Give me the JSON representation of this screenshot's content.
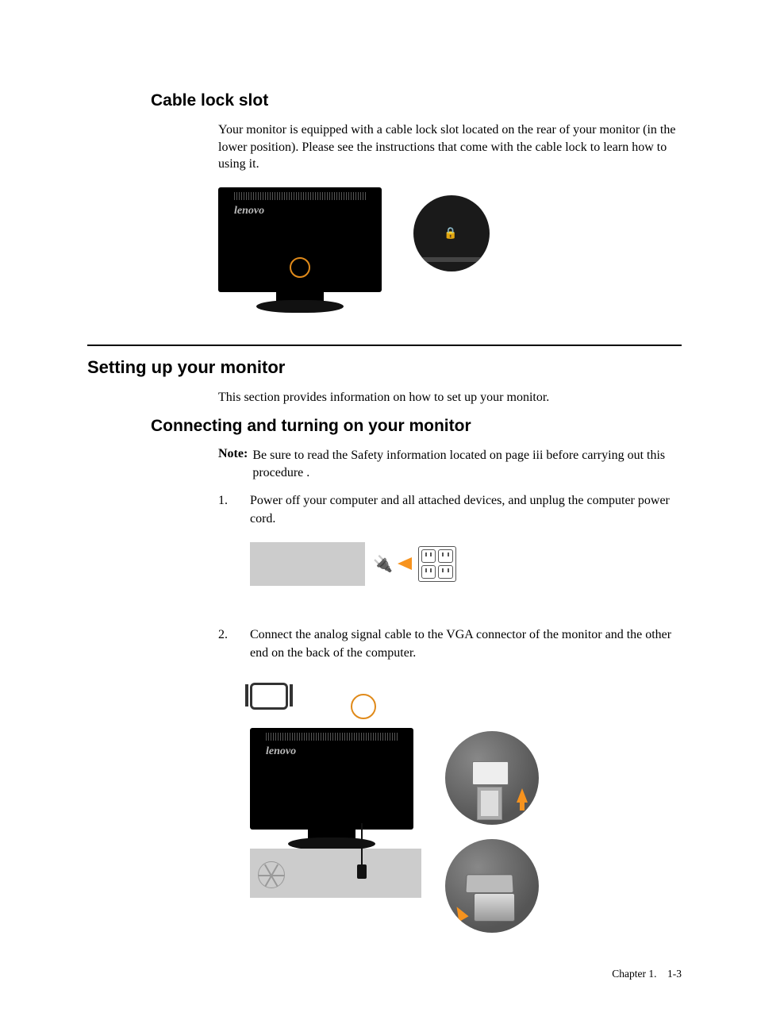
{
  "section1": {
    "heading": "Cable lock slot",
    "body": "Your monitor is equipped with a cable lock slot located on the rear of your monitor (in the lower position). Please see the instructions that come with the cable lock to learn how to using it.",
    "logo": "lenovo"
  },
  "section2": {
    "heading": "Setting up your monitor",
    "intro": "This section provides information on how to set up your monitor."
  },
  "section3": {
    "heading": "Connecting and turning on your monitor",
    "note_label": "Note:",
    "note": "Be sure to read the Safety information located on page iii before carrying out this procedure .",
    "step1_num": "1.",
    "step1": "Power off your computer and all attached devices, and unplug the computer power cord.",
    "step2_num": "2.",
    "step2": "Connect the analog signal cable to the VGA connector of  the monitor and the other end on the back of the computer.",
    "logo": "lenovo"
  },
  "footer": {
    "chapter": "Chapter 1.",
    "page": "1-3"
  }
}
